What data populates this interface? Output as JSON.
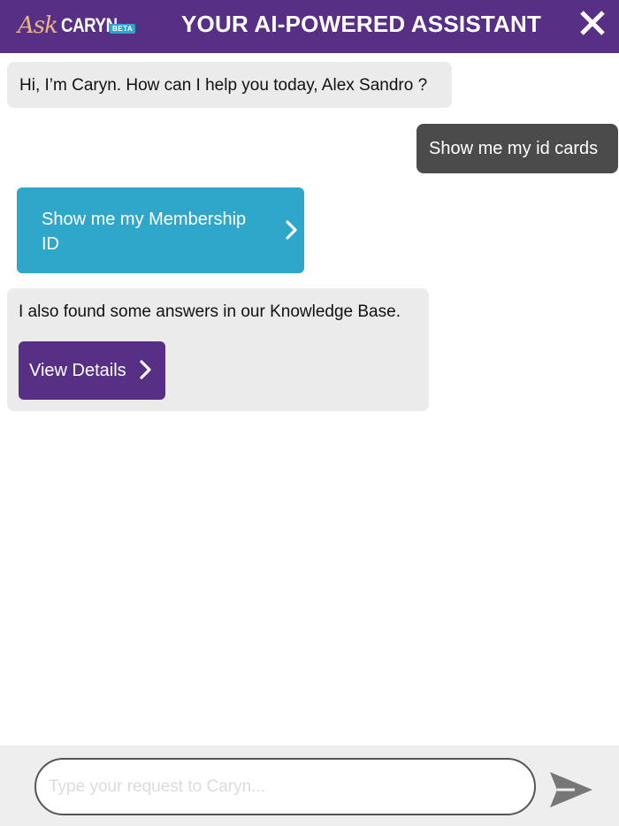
{
  "header": {
    "logo": {
      "ask": "Ask",
      "name": "CARYN",
      "badge": "BETA"
    },
    "title": "YOUR AI-POWERED ASSISTANT",
    "close_icon": "close-icon"
  },
  "messages": {
    "greeting": "Hi, I’m Caryn. How can I help you today, Alex Sandro ?",
    "user_request": "Show me my id cards",
    "membership_button": "Show me my Membership ID",
    "kb_text": "I also found some answers in our Knowledge Base.",
    "view_details_button": "View Details"
  },
  "composer": {
    "placeholder": "Type your request to Caryn...",
    "value": "",
    "send_icon": "send-icon"
  },
  "colors": {
    "brand_purple": "#573085",
    "accent_blue": "#2fa7cb",
    "user_bubble": "#4b4b4b",
    "bot_bubble": "#ebebeb"
  }
}
